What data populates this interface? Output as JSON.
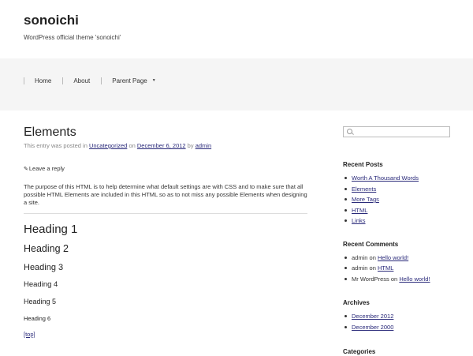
{
  "site": {
    "title": "sonoichi",
    "description": "WordPress official theme 'sonoichi'"
  },
  "nav": {
    "items": [
      {
        "label": "Home"
      },
      {
        "label": "About"
      },
      {
        "label": "Parent Page"
      }
    ],
    "parent_caret": "▼"
  },
  "post": {
    "title": "Elements",
    "meta_prefix": "This entry was posted in",
    "category": "Uncategorized",
    "meta_on": "on",
    "date": "December 6, 2012",
    "meta_by": "by",
    "author": "admin",
    "reply_icon": "✎",
    "reply_label": "Leave a reply",
    "intro": "The purpose of this HTML is to help determine what default settings are with CSS and to make sure that all possible HTML Elements are included in this HTML so as to not miss any possible Elements when designing a site.",
    "headings": {
      "h1": "Heading 1",
      "h2": "Heading 2",
      "h3": "Heading 3",
      "h4": "Heading 4",
      "h5": "Heading 5",
      "h6": "Heading 6"
    },
    "top_link": "[top]"
  },
  "sidebar": {
    "search": {
      "placeholder": "",
      "value": ""
    },
    "recent_posts": {
      "title": "Recent Posts",
      "items": [
        "Worth A Thousand Words",
        "Elements",
        "More Tags",
        "HTML",
        "Links"
      ]
    },
    "recent_comments": {
      "title": "Recent Comments",
      "items": [
        {
          "author": "admin",
          "on": "on",
          "post": "Hello world!"
        },
        {
          "author": "admin",
          "on": "on",
          "post": "HTML"
        },
        {
          "author": "Mr WordPress",
          "on": "on",
          "post": "Hello world!"
        }
      ]
    },
    "archives": {
      "title": "Archives",
      "items": [
        "December 2012",
        "December 2000"
      ]
    },
    "categories": {
      "title": "Categories"
    }
  }
}
